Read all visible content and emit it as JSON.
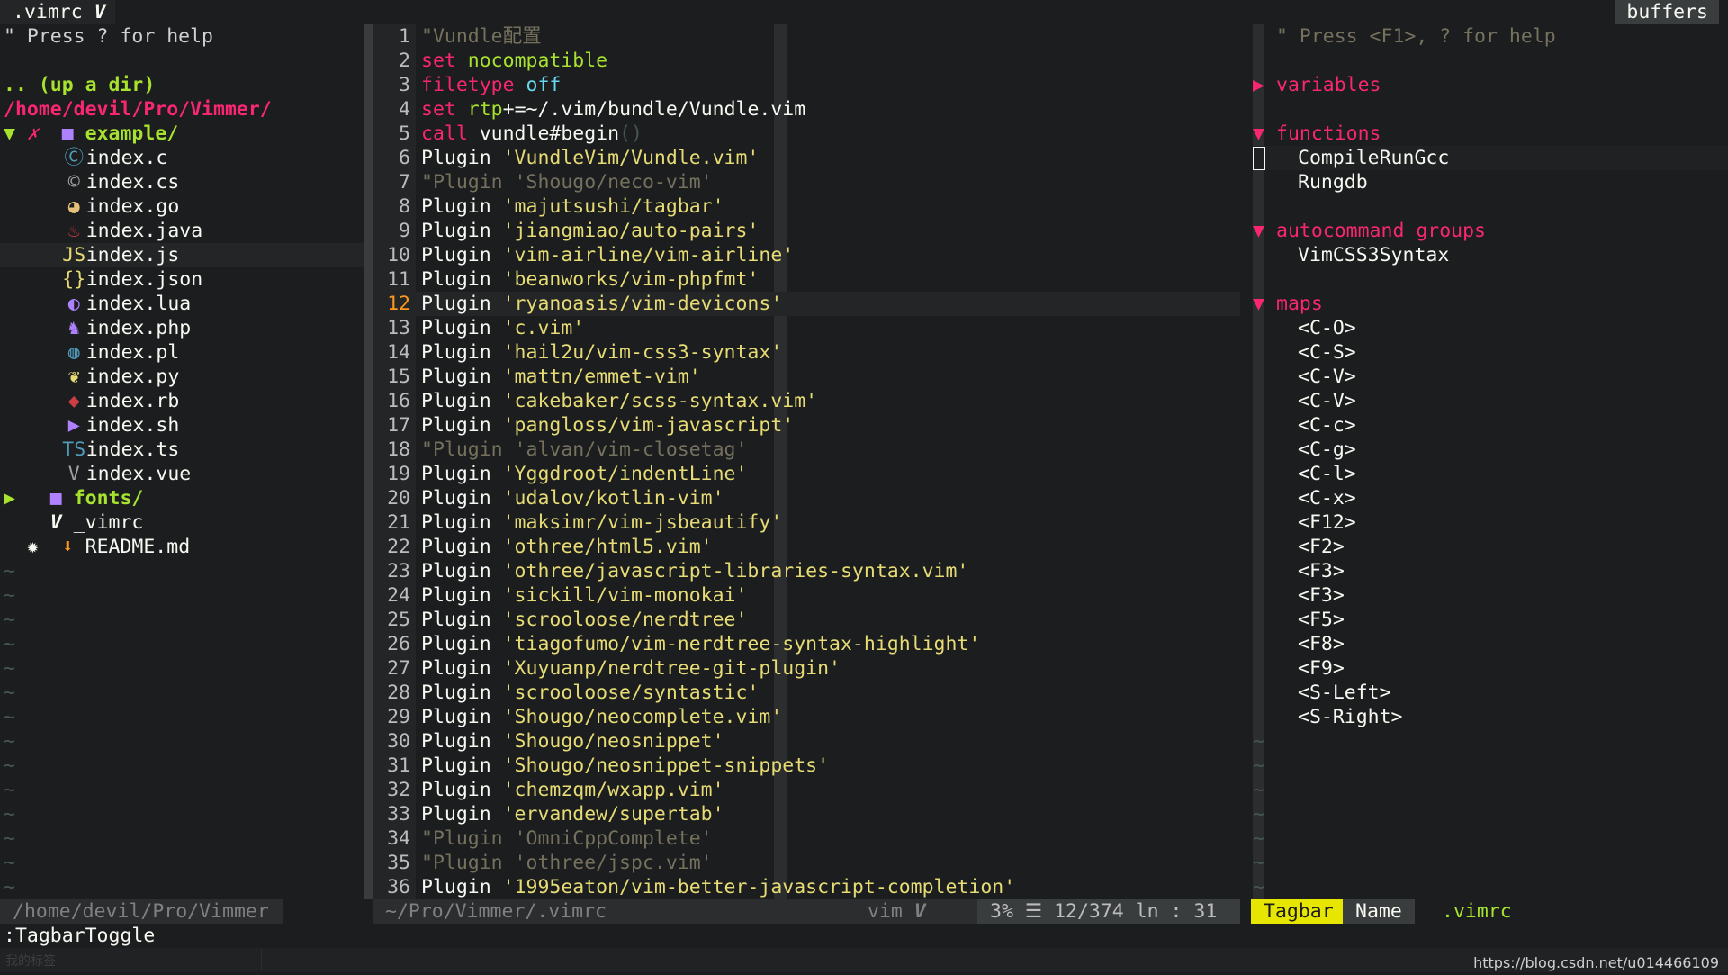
{
  "tabline": {
    "file_tab": ".vimrc",
    "file_tab_icon": "V",
    "buffers_label": "buffers"
  },
  "nerdtree": {
    "help": "\" Press ? for help",
    "up_dir": ".. (up a dir)",
    "root": "/home/devil/Pro/Vimmer/",
    "example_dir": "example/",
    "example_arrow": "▼",
    "example_git": "✗",
    "files": [
      {
        "icon": "c-icon",
        "glyph": "Ⓒ",
        "color": "#519aba",
        "name": "index.c"
      },
      {
        "icon": "csharp-icon",
        "glyph": "©",
        "color": "#a0a0a0",
        "name": "index.cs"
      },
      {
        "icon": "go-icon",
        "glyph": "◕",
        "color": "#e6c07b",
        "name": "index.go"
      },
      {
        "icon": "java-icon",
        "glyph": "♨",
        "color": "#cc3e44",
        "name": "index.java"
      },
      {
        "icon": "js-icon",
        "glyph": "JS",
        "color": "#e6db74",
        "name": "index.js"
      },
      {
        "icon": "json-icon",
        "glyph": "{}",
        "color": "#e6db74",
        "name": "index.json"
      },
      {
        "icon": "lua-icon",
        "glyph": "◐",
        "color": "#ae81ff",
        "name": "index.lua"
      },
      {
        "icon": "php-icon",
        "glyph": "♞",
        "color": "#ae81ff",
        "name": "index.php"
      },
      {
        "icon": "perl-icon",
        "glyph": "◍",
        "color": "#519aba",
        "name": "index.pl"
      },
      {
        "icon": "python-icon",
        "glyph": "❦",
        "color": "#e6db74",
        "name": "index.py"
      },
      {
        "icon": "ruby-icon",
        "glyph": "◆",
        "color": "#cc3e44",
        "name": "index.rb"
      },
      {
        "icon": "shell-icon",
        "glyph": "▶",
        "color": "#ae81ff",
        "name": "index.sh"
      },
      {
        "icon": "ts-icon",
        "glyph": "TS",
        "color": "#519aba",
        "name": "index.ts"
      },
      {
        "icon": "vue-icon",
        "glyph": "V",
        "color": "#a0a0a0",
        "name": "index.vue"
      }
    ],
    "fonts_dir": "fonts/",
    "fonts_arrow": "▶",
    "vimrc_file": "_vimrc",
    "vimrc_icon": "V",
    "readme_git": "✹",
    "readme_icon": "⬇",
    "readme_file": "README.md",
    "tilde_count": 14,
    "tilde": "~"
  },
  "editor": {
    "current_line": 12,
    "lines": [
      {
        "n": "1",
        "parts": [
          [
            "comment",
            "\"Vundle配置"
          ]
        ]
      },
      {
        "n": "2",
        "parts": [
          [
            "kw",
            "set"
          ],
          [
            "plain",
            " "
          ],
          [
            "kw-green",
            "nocompatible"
          ]
        ]
      },
      {
        "n": "3",
        "parts": [
          [
            "kw",
            "filetype"
          ],
          [
            "plain",
            " "
          ],
          [
            "const",
            "off"
          ]
        ]
      },
      {
        "n": "4",
        "parts": [
          [
            "kw",
            "set"
          ],
          [
            "plain",
            " "
          ],
          [
            "kw-green",
            "rtp"
          ],
          [
            "plain",
            "+=~/.vim/bundle/Vundle.vim"
          ]
        ]
      },
      {
        "n": "5",
        "parts": [
          [
            "kw",
            "call"
          ],
          [
            "plain",
            " vundle#begin"
          ],
          [
            "paren",
            "()"
          ]
        ]
      },
      {
        "n": "6",
        "parts": [
          [
            "plain",
            "Plugin "
          ],
          [
            "str",
            "'VundleVim/Vundle.vim'"
          ]
        ]
      },
      {
        "n": "7",
        "parts": [
          [
            "comment",
            "\"Plugin 'Shougo/neco-vim'"
          ]
        ]
      },
      {
        "n": "8",
        "parts": [
          [
            "plain",
            "Plugin "
          ],
          [
            "str",
            "'majutsushi/tagbar'"
          ]
        ]
      },
      {
        "n": "9",
        "parts": [
          [
            "plain",
            "Plugin "
          ],
          [
            "str",
            "'jiangmiao/auto-pairs'"
          ]
        ]
      },
      {
        "n": "10",
        "parts": [
          [
            "plain",
            "Plugin "
          ],
          [
            "str",
            "'vim-airline/vim-airline'"
          ]
        ]
      },
      {
        "n": "11",
        "parts": [
          [
            "plain",
            "Plugin "
          ],
          [
            "str",
            "'beanworks/vim-phpfmt'"
          ]
        ]
      },
      {
        "n": "12",
        "parts": [
          [
            "plain",
            "Plugin "
          ],
          [
            "str",
            "'ryanoasis/vim-devicons'"
          ]
        ]
      },
      {
        "n": "13",
        "parts": [
          [
            "plain",
            "Plugin "
          ],
          [
            "str",
            "'c.vim'"
          ]
        ]
      },
      {
        "n": "14",
        "parts": [
          [
            "plain",
            "Plugin "
          ],
          [
            "str",
            "'hail2u/vim-css3-syntax'"
          ]
        ]
      },
      {
        "n": "15",
        "parts": [
          [
            "plain",
            "Plugin "
          ],
          [
            "str",
            "'mattn/emmet-vim'"
          ]
        ]
      },
      {
        "n": "16",
        "parts": [
          [
            "plain",
            "Plugin "
          ],
          [
            "str",
            "'cakebaker/scss-syntax.vim'"
          ]
        ]
      },
      {
        "n": "17",
        "parts": [
          [
            "plain",
            "Plugin "
          ],
          [
            "str",
            "'pangloss/vim-javascript'"
          ]
        ]
      },
      {
        "n": "18",
        "parts": [
          [
            "comment",
            "\"Plugin 'alvan/vim-closetag'"
          ]
        ]
      },
      {
        "n": "19",
        "parts": [
          [
            "plain",
            "Plugin "
          ],
          [
            "str",
            "'Yggdroot/indentLine'"
          ]
        ]
      },
      {
        "n": "20",
        "parts": [
          [
            "plain",
            "Plugin "
          ],
          [
            "str",
            "'udalov/kotlin-vim'"
          ]
        ]
      },
      {
        "n": "21",
        "parts": [
          [
            "plain",
            "Plugin "
          ],
          [
            "str",
            "'maksimr/vim-jsbeautify'"
          ]
        ]
      },
      {
        "n": "22",
        "parts": [
          [
            "plain",
            "Plugin "
          ],
          [
            "str",
            "'othree/html5.vim'"
          ]
        ]
      },
      {
        "n": "23",
        "parts": [
          [
            "plain",
            "Plugin "
          ],
          [
            "str",
            "'othree/javascript-libraries-syntax.vim'"
          ]
        ]
      },
      {
        "n": "24",
        "parts": [
          [
            "plain",
            "Plugin "
          ],
          [
            "str",
            "'sickill/vim-monokai'"
          ]
        ]
      },
      {
        "n": "25",
        "parts": [
          [
            "plain",
            "Plugin "
          ],
          [
            "str",
            "'scrooloose/nerdtree'"
          ]
        ]
      },
      {
        "n": "26",
        "parts": [
          [
            "plain",
            "Plugin "
          ],
          [
            "str",
            "'tiagofumo/vim-nerdtree-syntax-highlight'"
          ]
        ]
      },
      {
        "n": "27",
        "parts": [
          [
            "plain",
            "Plugin "
          ],
          [
            "str",
            "'Xuyuanp/nerdtree-git-plugin'"
          ]
        ]
      },
      {
        "n": "28",
        "parts": [
          [
            "plain",
            "Plugin "
          ],
          [
            "str",
            "'scrooloose/syntastic'"
          ]
        ]
      },
      {
        "n": "29",
        "parts": [
          [
            "plain",
            "Plugin "
          ],
          [
            "str",
            "'Shougo/neocomplete.vim'"
          ]
        ]
      },
      {
        "n": "30",
        "parts": [
          [
            "plain",
            "Plugin "
          ],
          [
            "str",
            "'Shougo/neosnippet'"
          ]
        ]
      },
      {
        "n": "31",
        "parts": [
          [
            "plain",
            "Plugin "
          ],
          [
            "str",
            "'Shougo/neosnippet-snippets'"
          ]
        ]
      },
      {
        "n": "32",
        "parts": [
          [
            "plain",
            "Plugin "
          ],
          [
            "str",
            "'chemzqm/wxapp.vim'"
          ]
        ]
      },
      {
        "n": "33",
        "parts": [
          [
            "plain",
            "Plugin "
          ],
          [
            "str",
            "'ervandew/supertab'"
          ]
        ]
      },
      {
        "n": "34",
        "parts": [
          [
            "comment",
            "\"Plugin 'OmniCppComplete'"
          ]
        ]
      },
      {
        "n": "35",
        "parts": [
          [
            "comment",
            "\"Plugin 'othree/jspc.vim'"
          ]
        ]
      },
      {
        "n": "36",
        "parts": [
          [
            "plain",
            "Plugin "
          ],
          [
            "str",
            "'1995eaton/vim-better-javascript-completion'"
          ]
        ]
      }
    ]
  },
  "tagbar": {
    "help": "\" Press <F1>, ? for help",
    "sections": [
      {
        "kind": "variables",
        "collapsed": true,
        "items": []
      },
      {
        "kind": "functions",
        "collapsed": false,
        "items": [
          "CompileRunGcc",
          "Rungdb"
        ]
      },
      {
        "kind": "autocommand groups",
        "collapsed": false,
        "items": [
          "VimCSS3Syntax"
        ]
      },
      {
        "kind": "maps",
        "collapsed": false,
        "items": [
          "<C-O>",
          "<C-S>",
          "<C-V>",
          "<C-V>",
          "<C-c>",
          "<C-g>",
          "<C-l>",
          "<C-x>",
          "<F12>",
          "<F2>",
          "<F3>",
          "<F3>",
          "<F5>",
          "<F8>",
          "<F9>",
          "<S-Left>",
          "<S-Right>"
        ]
      }
    ],
    "tilde_count": 7,
    "tilde": "~"
  },
  "status": {
    "left_path": "/home/devil/Pro/Vimmer",
    "mid_path": "~/Pro/Vimmer/.vimrc",
    "mid_filetype": "vim",
    "mid_filetype_icon": "V",
    "mid_percent": "3%",
    "mid_menu_icon": "☰",
    "mid_pos": "12/374",
    "mid_ln": "ln : 31",
    "tagbar_label": "Tagbar",
    "name_label": "Name",
    "file_label": ".vimrc"
  },
  "cmdline": ":TagbarToggle",
  "overlay": {
    "label": "我的标签",
    "watermark": "https://blog.csdn.net/u014466109"
  }
}
